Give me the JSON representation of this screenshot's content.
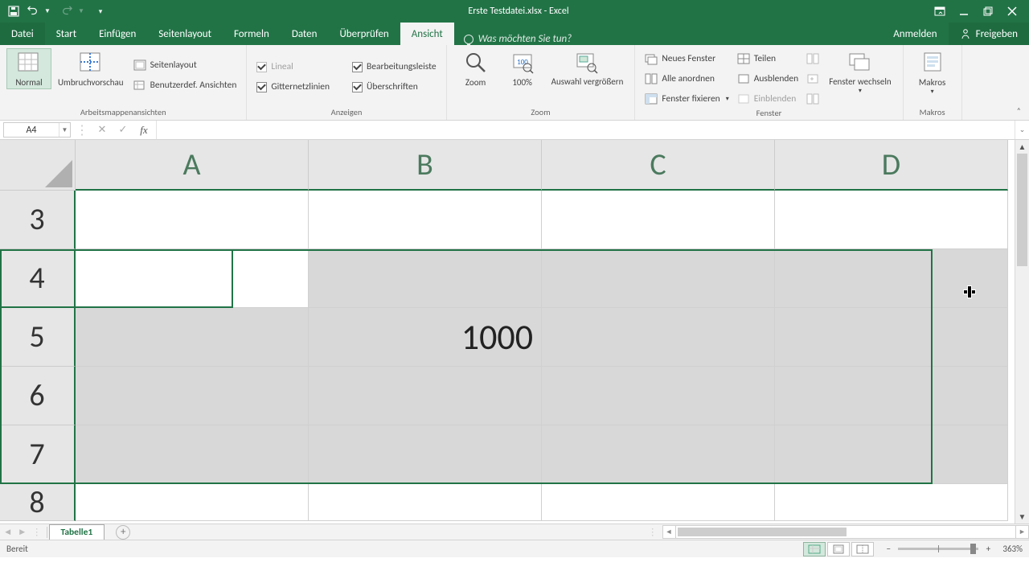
{
  "titleBar": {
    "title": "Erste Testdatei.xlsx - Excel"
  },
  "tabs": {
    "file": "Datei",
    "list": [
      "Start",
      "Einfügen",
      "Seitenlayout",
      "Formeln",
      "Daten",
      "Überprüfen",
      "Ansicht"
    ],
    "activeIndex": 6,
    "tellMe": "Was möchten Sie tun?",
    "signIn": "Anmelden",
    "share": "Freigeben"
  },
  "ribbon": {
    "groups": {
      "views": {
        "label": "Arbeitsmappenansichten",
        "normal": "Normal",
        "pageBreak": "Umbruchvorschau",
        "pageLayout": "Seitenlayout",
        "custom": "Benutzerdef. Ansichten"
      },
      "show": {
        "label": "Anzeigen",
        "ruler": "Lineal",
        "gridlines": "Gitternetzlinien",
        "formulaBar": "Bearbeitungsleiste",
        "headings": "Überschriften"
      },
      "zoom": {
        "label": "Zoom",
        "zoom": "Zoom",
        "p100": "100%",
        "selection": "Auswahl vergrößern"
      },
      "window": {
        "label": "Fenster",
        "newWin": "Neues Fenster",
        "arrange": "Alle anordnen",
        "freeze": "Fenster fixieren",
        "split": "Teilen",
        "hide": "Ausblenden",
        "unhide": "Einblenden",
        "switch": "Fenster wechseln"
      },
      "macros": {
        "label": "Makros",
        "macros": "Makros"
      }
    }
  },
  "nameBox": {
    "value": "A4"
  },
  "formulaBar": {
    "value": ""
  },
  "grid": {
    "cols": [
      "A",
      "B",
      "C",
      "D"
    ],
    "rows": [
      "3",
      "4",
      "5",
      "6",
      "7",
      "8"
    ],
    "cells": {
      "B5": "1000"
    },
    "activeCell": "A4"
  },
  "sheet": {
    "active": "Tabelle1"
  },
  "status": {
    "ready": "Bereit",
    "zoom": "363%"
  }
}
